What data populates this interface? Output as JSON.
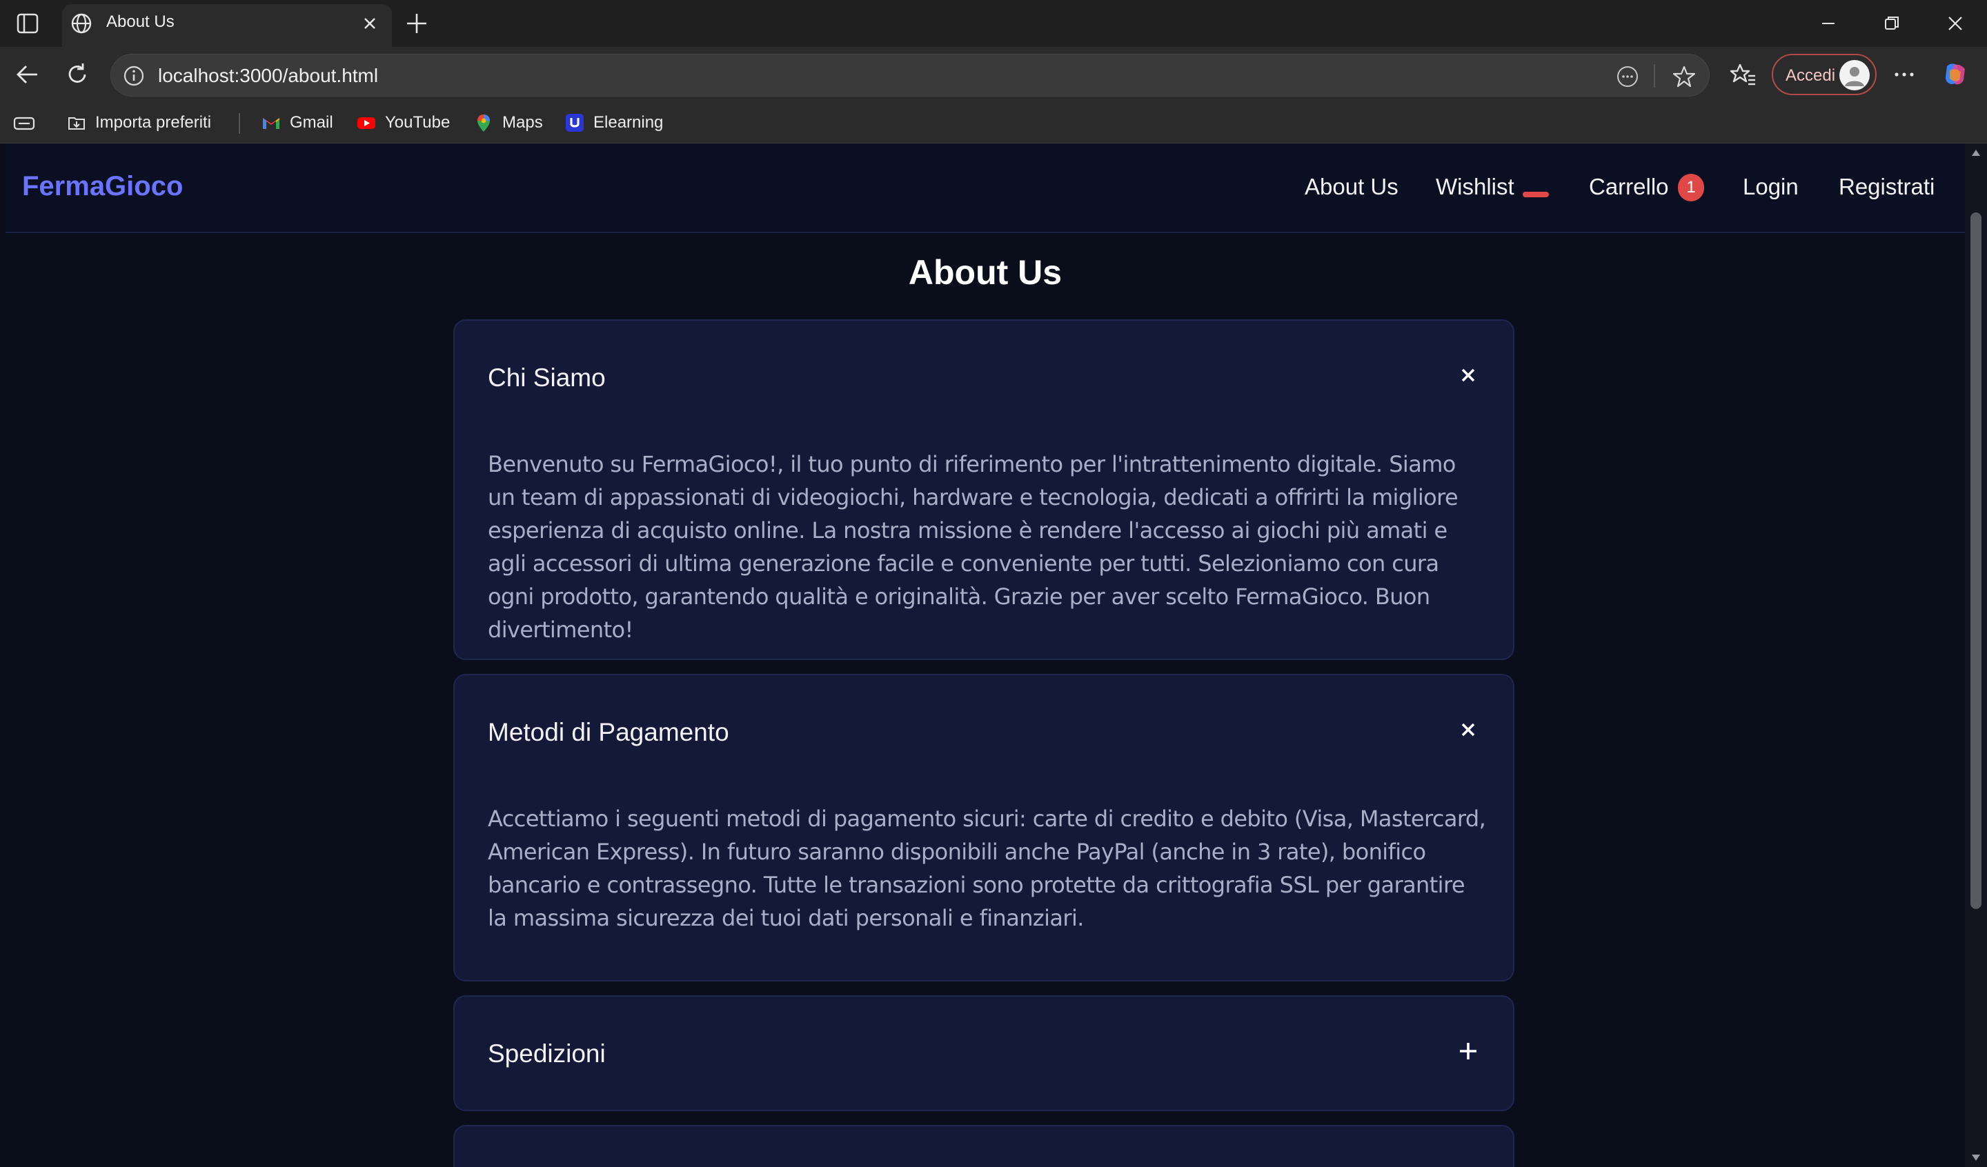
{
  "browser": {
    "tab_title": "About Us",
    "url": "localhost:3000/about.html",
    "accedi_label": "Accedi",
    "bookmarks": [
      {
        "label": "Importa preferiti",
        "icon": "import-favorites-icon"
      },
      {
        "label": "Gmail",
        "icon": "gmail-icon"
      },
      {
        "label": "YouTube",
        "icon": "youtube-icon"
      },
      {
        "label": "Maps",
        "icon": "maps-icon"
      },
      {
        "label": "Elearning",
        "icon": "elearning-icon"
      }
    ]
  },
  "site": {
    "logo": "FermaGioco",
    "nav": {
      "about": "About Us",
      "wishlist": "Wishlist",
      "cart": "Carrello",
      "cart_count": "1",
      "login": "Login",
      "register": "Registrati"
    },
    "page_title": "About Us",
    "sections": [
      {
        "title": "Chi Siamo",
        "expanded": true,
        "toggle": "×",
        "body": "Benvenuto su FermaGioco!, il tuo punto di riferimento per l'intrattenimento digitale. Siamo un team di appassionati di videogiochi, hardware e tecnologia, dedicati a offrirti la migliore esperienza di acquisto online. La nostra missione è rendere l'accesso ai giochi più amati e agli accessori di ultima generazione facile e conveniente per tutti. Selezioniamo con cura ogni prodotto, garantendo qualità e originalità. Grazie per aver scelto FermaGioco. Buon divertimento!"
      },
      {
        "title": "Metodi di Pagamento",
        "expanded": true,
        "toggle": "×",
        "body": "Accettiamo i seguenti metodi di pagamento sicuri: carte di credito e debito (Visa, Mastercard, American Express). In futuro saranno disponibili anche PayPal (anche in 3 rate), bonifico bancario e contrassegno. Tutte le transazioni sono protette da crittografia SSL per garantire la massima sicurezza dei tuoi dati personali e finanziari."
      },
      {
        "title": "Spedizioni",
        "expanded": false,
        "toggle": "+"
      }
    ]
  },
  "colors": {
    "accent": "#6b74ff",
    "badge": "#e04848",
    "card_bg": "#131937",
    "page_bg": "#0a0d1a"
  }
}
